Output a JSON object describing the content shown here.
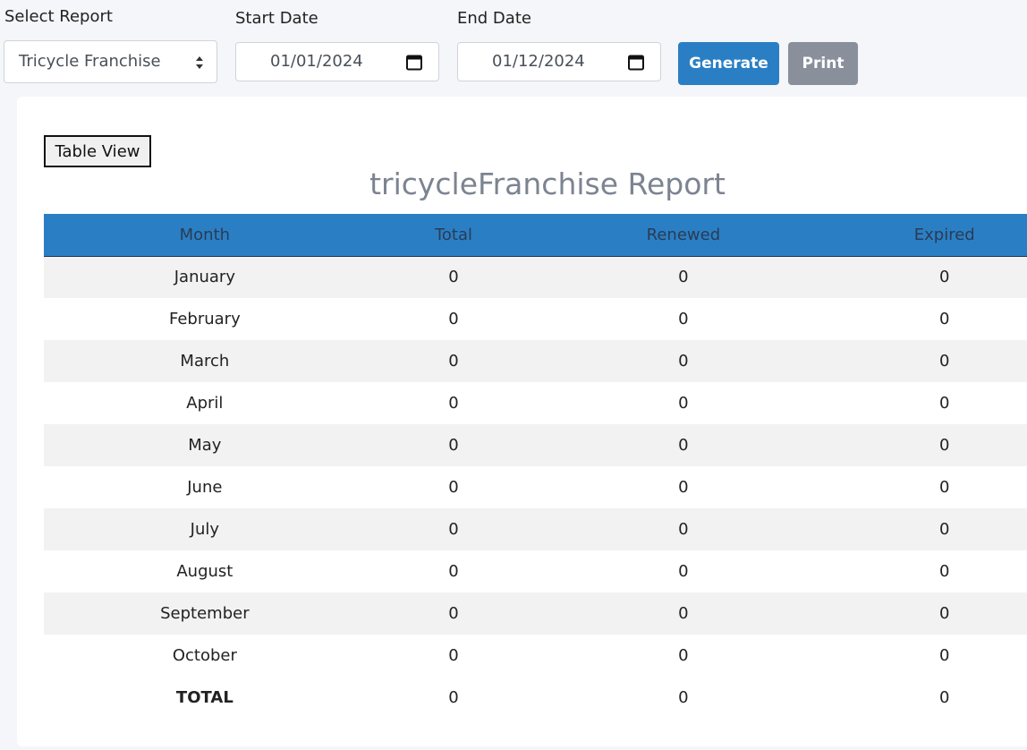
{
  "filters": {
    "report_label": "Select Report",
    "report_value": "Tricycle Franchise",
    "start_label": "Start Date",
    "start_value": "01/01/2024",
    "end_label": "End Date",
    "end_value": "01/12/2024"
  },
  "buttons": {
    "generate": "Generate",
    "print": "Print",
    "table_view": "Table View"
  },
  "report": {
    "title": "tricycleFranchise Report",
    "columns": [
      "Month",
      "Total",
      "Renewed",
      "Expired"
    ],
    "rows": [
      {
        "month": "January",
        "total": "0",
        "renewed": "0",
        "expired": "0"
      },
      {
        "month": "February",
        "total": "0",
        "renewed": "0",
        "expired": "0"
      },
      {
        "month": "March",
        "total": "0",
        "renewed": "0",
        "expired": "0"
      },
      {
        "month": "April",
        "total": "0",
        "renewed": "0",
        "expired": "0"
      },
      {
        "month": "May",
        "total": "0",
        "renewed": "0",
        "expired": "0"
      },
      {
        "month": "June",
        "total": "0",
        "renewed": "0",
        "expired": "0"
      },
      {
        "month": "July",
        "total": "0",
        "renewed": "0",
        "expired": "0"
      },
      {
        "month": "August",
        "total": "0",
        "renewed": "0",
        "expired": "0"
      },
      {
        "month": "September",
        "total": "0",
        "renewed": "0",
        "expired": "0"
      },
      {
        "month": "October",
        "total": "0",
        "renewed": "0",
        "expired": "0"
      }
    ],
    "total_row": {
      "month": "TOTAL",
      "total": "0",
      "renewed": "0",
      "expired": "0"
    }
  },
  "icons": {
    "select": "sort-caret-icon",
    "date": "calendar-icon"
  },
  "colors": {
    "primary": "#2a7fc4",
    "secondary": "#8a8f9c",
    "title": "#7c8491"
  }
}
